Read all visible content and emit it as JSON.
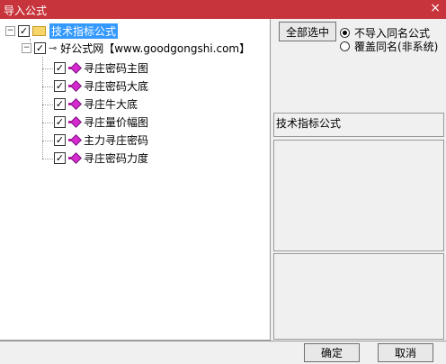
{
  "window": {
    "title": "导入公式",
    "close_glyph": "×"
  },
  "tree": {
    "root": {
      "label": "技术指标公式",
      "checked": true,
      "expanded": true
    },
    "source": {
      "label": "好公式网【www.goodgongshi.com】",
      "checked": true,
      "expanded": true
    },
    "items": [
      {
        "label": "寻庄密码主图",
        "checked": true
      },
      {
        "label": "寻庄密码大底",
        "checked": true
      },
      {
        "label": "寻庄牛大底",
        "checked": true
      },
      {
        "label": "寻庄量价幅图",
        "checked": true
      },
      {
        "label": "主力寻庄密码",
        "checked": true
      },
      {
        "label": "寻庄密码力度",
        "checked": true
      }
    ]
  },
  "options": {
    "select_all_label": "全部选中",
    "radio_skip_label": "不导入同名公式",
    "radio_overwrite_label": "覆盖同名(非系统)",
    "selected_radio": "skip"
  },
  "info": {
    "category_label": "技术指标公式"
  },
  "footer": {
    "ok_label": "确定",
    "cancel_label": "取消"
  }
}
